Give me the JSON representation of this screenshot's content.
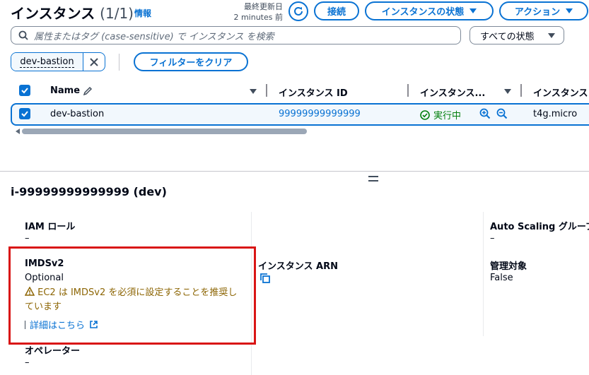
{
  "header": {
    "title": "インスタンス",
    "count": "(1/1)",
    "info": "情報",
    "last_updated_label": "最終更新日",
    "last_updated_value": "2 minutes 前",
    "connect_label": "接続",
    "instance_state_label": "インスタンスの状態",
    "actions_label": "アクション"
  },
  "search": {
    "placeholder": "属性またはタグ (case-sensitive) で インスタンス を検索",
    "state_filter": "すべての状態"
  },
  "filter": {
    "token": "dev-bastion",
    "clear_label": "フィルターをクリア"
  },
  "table": {
    "columns": [
      "Name",
      "インスタンス ID",
      "インスタンス...",
      "インスタンス"
    ],
    "rows": [
      {
        "name": "dev-bastion",
        "instance_id": "99999999999999",
        "state": "実行中",
        "type": "t4g.micro"
      }
    ]
  },
  "details": {
    "title": "i-99999999999999 (dev)",
    "iam_role_label": "IAM ロール",
    "iam_role_value": "–",
    "imds_label": "IMDSv2",
    "imds_value": "Optional",
    "imds_warning": "EC2 は IMDSv2 を必須に設定することを推奨しています",
    "imds_details_link": "詳細はこちら",
    "operator_label": "オペレーター",
    "operator_value": "–",
    "arn_label": "インスタンス ARN",
    "asg_label": "Auto Scaling グループ",
    "asg_value": "–",
    "managed_label": "管理対象",
    "managed_value": "False"
  },
  "colors": {
    "accent": "#0972d3",
    "highlight_box": "#d91515",
    "success": "#037f0c",
    "warning": "#8d6605"
  }
}
